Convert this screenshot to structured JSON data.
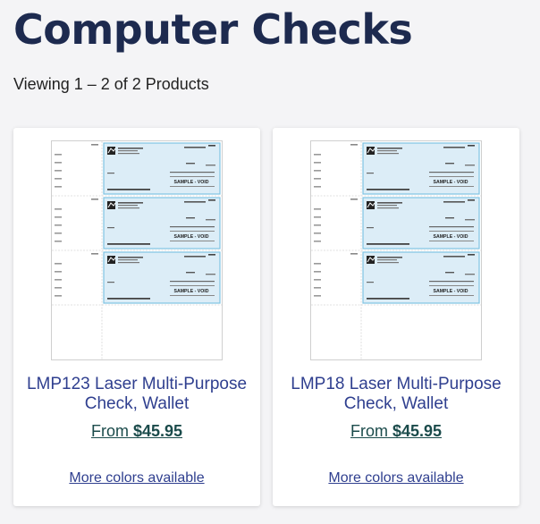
{
  "page": {
    "title": "Computer Checks",
    "viewing_text": "Viewing 1 – 2 of 2 Products"
  },
  "products": [
    {
      "title": "LMP123 Laser Multi-Purpose Check, Wallet",
      "price_prefix": "From",
      "price": "$45.95",
      "more_colors": "More colors available",
      "thumbnail": {
        "check_label": "SAMPLE - VOID"
      }
    },
    {
      "title": "LMP18 Laser Multi-Purpose Check, Wallet",
      "price_prefix": "From",
      "price": "$45.95",
      "more_colors": "More colors available",
      "thumbnail": {
        "check_label": "SAMPLE - VOID"
      }
    }
  ],
  "colors": {
    "title": "#1d2a4f",
    "link": "#2f3f8f",
    "price": "#1b4b4b",
    "check_fill": "#dcedf7",
    "check_border": "#7ec3e3"
  }
}
